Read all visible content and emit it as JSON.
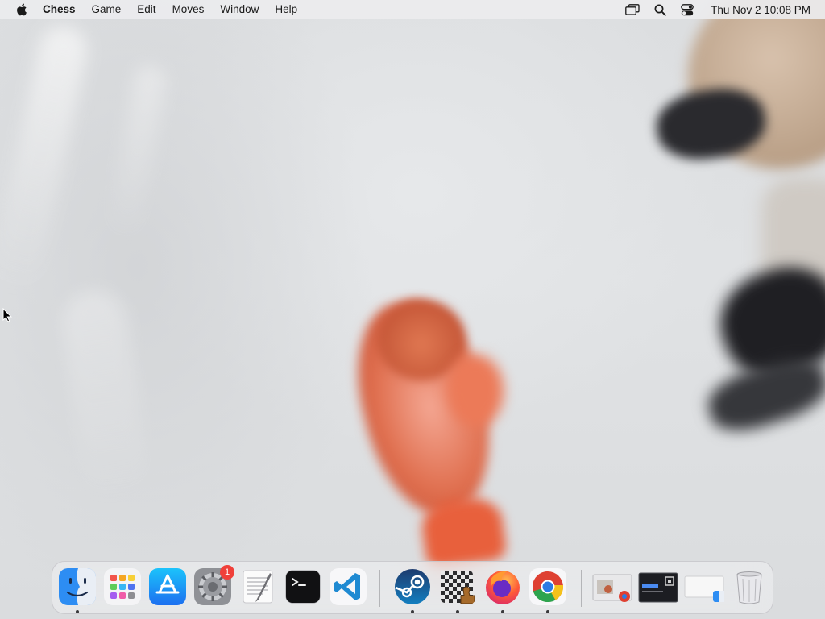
{
  "menubar": {
    "app_name": "Chess",
    "menus": [
      "Game",
      "Edit",
      "Moves",
      "Window",
      "Help"
    ],
    "status_icons": [
      "screen-mirroring-icon",
      "spotlight-search-icon",
      "control-center-icon"
    ],
    "clock": "Thu Nov 2  10:08 PM"
  },
  "dock": {
    "apps": [
      {
        "name": "Finder",
        "icon": "finder-icon",
        "running": true
      },
      {
        "name": "Launchpad",
        "icon": "launchpad-icon",
        "running": false
      },
      {
        "name": "App Store",
        "icon": "app-store-icon",
        "running": false
      },
      {
        "name": "System Settings",
        "icon": "system-settings-icon",
        "running": false,
        "badge": "1"
      },
      {
        "name": "TextEdit",
        "icon": "textedit-icon",
        "running": false
      },
      {
        "name": "Terminal",
        "icon": "terminal-icon",
        "running": false
      },
      {
        "name": "Visual Studio Code",
        "icon": "vscode-icon",
        "running": false
      },
      {
        "name": "Steam",
        "icon": "steam-icon",
        "running": true
      },
      {
        "name": "Chess",
        "icon": "chess-icon",
        "running": true
      },
      {
        "name": "Firefox",
        "icon": "firefox-icon",
        "running": true
      },
      {
        "name": "Google Chrome",
        "icon": "chrome-icon",
        "running": true
      }
    ],
    "minimized": [
      {
        "name": "Chrome window",
        "icon": "minimized-window-chrome"
      },
      {
        "name": "Dark window",
        "icon": "minimized-window-dark"
      },
      {
        "name": "Finder window",
        "icon": "minimized-window-finder"
      }
    ],
    "trash": {
      "name": "Trash",
      "icon": "trash-icon"
    }
  },
  "colors": {
    "menubar_bg": "#ececee",
    "badge": "#f0403a",
    "vscode_blue": "#1f8ad2",
    "steam_blue": "#1b2a4b"
  }
}
